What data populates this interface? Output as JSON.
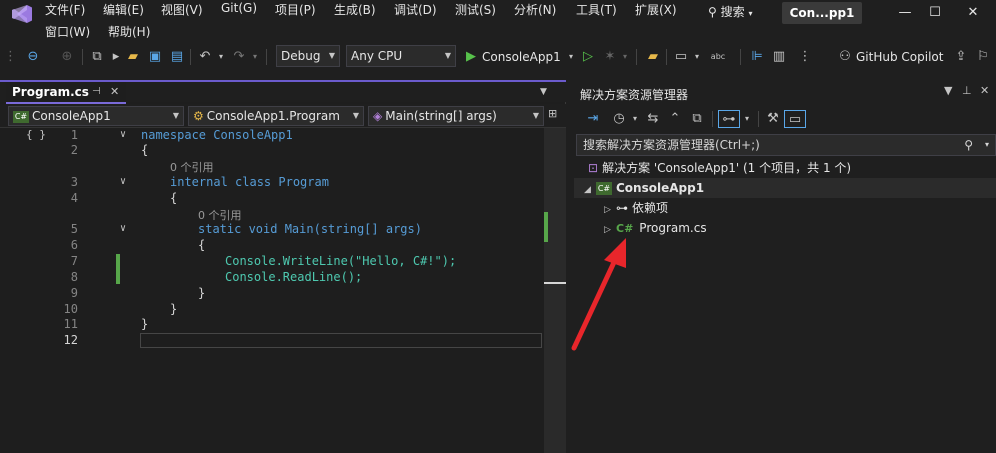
{
  "menu": {
    "file": "文件(F)",
    "edit": "编辑(E)",
    "view": "视图(V)",
    "git": "Git(G)",
    "project": "项目(P)",
    "build": "生成(B)",
    "debug": "调试(D)",
    "test": "测试(S)",
    "analyze": "分析(N)",
    "tools": "工具(T)",
    "extensions": "扩展(X)",
    "window": "窗口(W)",
    "help": "帮助(H)"
  },
  "search": {
    "label": "搜索"
  },
  "solution_title": "Con...pp1",
  "toolbar": {
    "config": "Debug",
    "platform": "Any CPU",
    "start_project": "ConsoleApp1",
    "copilot": "GitHub Copilot"
  },
  "editor": {
    "tab_label": "Program.cs",
    "nav": {
      "project": "ConsoleApp1",
      "class": "ConsoleApp1.Program",
      "member": "Main(string[] args)"
    },
    "lines": [
      {
        "n": "1",
        "text": "namespace ConsoleApp1"
      },
      {
        "n": "2",
        "text": "{"
      },
      {
        "n": "3",
        "text": "internal class Program"
      },
      {
        "n": "4",
        "text": "{"
      },
      {
        "n": "5",
        "text": "static void Main(string[] args)"
      },
      {
        "n": "6",
        "text": "{"
      },
      {
        "n": "7",
        "text": "Console.WriteLine(\"Hello, C#!\");"
      },
      {
        "n": "8",
        "text": "Console.ReadLine();"
      },
      {
        "n": "9",
        "text": "}"
      },
      {
        "n": "10",
        "text": "}"
      },
      {
        "n": "11",
        "text": "}"
      },
      {
        "n": "12",
        "text": ""
      }
    ],
    "codelens": "0 个引用"
  },
  "explorer": {
    "title": "解决方案资源管理器",
    "search_placeholder": "搜索解决方案资源管理器(Ctrl+;)",
    "solution": "解决方案 'ConsoleApp1' (1 个项目，共 1 个)",
    "project": "ConsoleApp1",
    "dependencies": "依赖项",
    "file": "Program.cs"
  },
  "colors": {
    "accent": "#6b5bcc",
    "keyword": "#569cd6",
    "type": "#4ec9b0",
    "string": "#d69d85",
    "method": "#dcdcaa",
    "annotation_arrow": "#e8262b"
  }
}
